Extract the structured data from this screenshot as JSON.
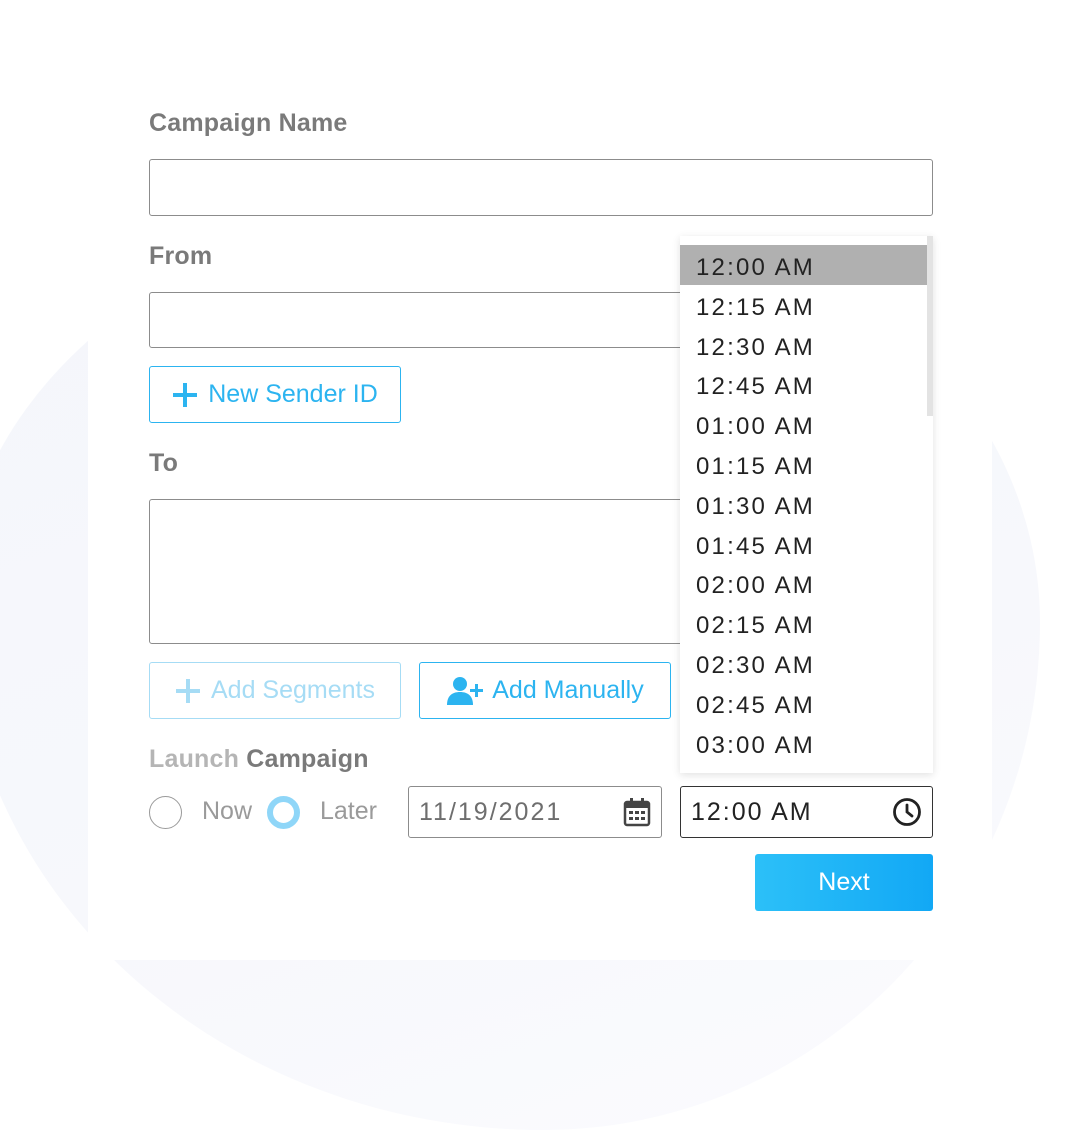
{
  "form": {
    "campaign_name_label": "Campaign Name",
    "campaign_name_value": "",
    "from_label": "From",
    "from_value": "",
    "new_sender_label": "New Sender ID",
    "to_label": "To",
    "to_value": "",
    "add_segments_label": "Add Segments",
    "add_manually_label": "Add Manually",
    "launch_label_part1": "Launch",
    "launch_label_part2": "Campaign",
    "now_label": "Now",
    "later_label": "Later",
    "selected_option": "Later",
    "date_value": "11/19/2021",
    "time_value": "12:00 AM",
    "next_label": "Next"
  },
  "time_dropdown": {
    "selected": "12:00 AM",
    "options": [
      "12:00 AM",
      "12:15 AM",
      "12:30 AM",
      "12:45 AM",
      "01:00 AM",
      "01:15 AM",
      "01:30 AM",
      "01:45 AM",
      "02:00 AM",
      "02:15 AM",
      "02:30 AM",
      "02:45 AM",
      "03:00 AM"
    ]
  },
  "icons": {
    "new_sender": "plus-icon",
    "add_segments": "plus-icon",
    "add_manually": "user-plus-icon",
    "date": "calendar-icon",
    "time": "clock-icon"
  },
  "colors": {
    "accent": "#2cb4f0",
    "accent_faded": "#a6dcf5",
    "label_gray": "#7a7a7a",
    "dropdown_selected": "#b0b0b0"
  }
}
